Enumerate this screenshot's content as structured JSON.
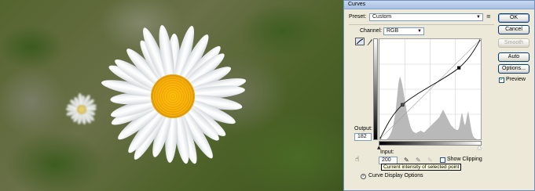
{
  "dialog": {
    "title": "Curves",
    "preset_label": "Preset:",
    "preset_value": "Custom",
    "channel_label": "Channel:",
    "channel_value": "RGB",
    "buttons": {
      "ok": "OK",
      "cancel": "Cancel",
      "smooth": "Smooth",
      "auto": "Auto",
      "options": "Options..."
    },
    "preview_label": "Preview",
    "preview_checked": true,
    "output_label": "Output:",
    "output_value": "182",
    "input_label": "Input:",
    "input_value": "200",
    "show_clipping_label": "Show Clipping",
    "show_clipping_checked": false,
    "tooltip": "Current intensity of selected point",
    "curve_display_label": "Curve Display Options"
  },
  "curve": {
    "points": [
      [
        0,
        0
      ],
      [
        58,
        88
      ],
      [
        200,
        182
      ],
      [
        255,
        255
      ]
    ]
  },
  "colors": {
    "title_bar": "#a7bfe3",
    "dialog_bg": "#ece9d8",
    "button_border": "#003c74",
    "tooltip_bg": "#ffffe1",
    "daisy_center": "#f5a800"
  },
  "icons": {
    "preset_menu": "preset-options-icon",
    "curve_tool": "curve-edit-icon",
    "pencil_tool": "pencil-icon",
    "hand_tool": "on-image-adjust-icon",
    "black_point": "black-eyedropper-icon",
    "gray_point": "gray-eyedropper-icon",
    "white_point": "white-eyedropper-icon",
    "expand": "expand-chevron-icon"
  }
}
